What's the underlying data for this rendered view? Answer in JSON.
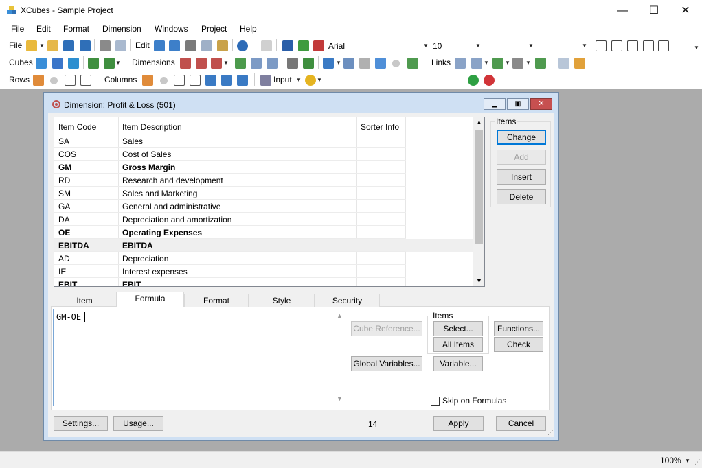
{
  "window": {
    "title": "XCubes - Sample Project",
    "minimize": "—",
    "maximize": "☐",
    "close": "✕"
  },
  "menu": [
    "File",
    "Edit",
    "Format",
    "Dimension",
    "Windows",
    "Project",
    "Help"
  ],
  "toolbar1": {
    "file_label": "File",
    "edit_label": "Edit",
    "font_name": "Arial",
    "font_size": "10"
  },
  "toolbar2": {
    "cubes_label": "Cubes",
    "dimensions_label": "Dimensions",
    "links_label": "Links"
  },
  "toolbar3": {
    "rows_label": "Rows",
    "columns_label": "Columns",
    "input_label": "Input"
  },
  "dialog": {
    "title": "Dimension: Profit & Loss (501)",
    "grid": {
      "headers": [
        "Item Code",
        "Item Description",
        "Sorter Info"
      ],
      "rows": [
        {
          "code": "SA",
          "desc": "Sales",
          "bold": false
        },
        {
          "code": "COS",
          "desc": "Cost of Sales",
          "bold": false
        },
        {
          "code": "GM",
          "desc": "Gross Margin",
          "bold": true
        },
        {
          "code": "RD",
          "desc": "Research and development",
          "bold": false
        },
        {
          "code": "SM",
          "desc": "Sales and Marketing",
          "bold": false
        },
        {
          "code": "GA",
          "desc": "General and administrative",
          "bold": false
        },
        {
          "code": "DA",
          "desc": "Depreciation and amortization",
          "bold": false
        },
        {
          "code": "OE",
          "desc": "Operating Expenses",
          "bold": true
        },
        {
          "code": "EBITDA",
          "desc": "EBITDA",
          "bold": true,
          "selected": true
        },
        {
          "code": "AD",
          "desc": "Depreciation",
          "bold": false
        },
        {
          "code": "IE",
          "desc": "Interest expenses",
          "bold": false
        },
        {
          "code": "EBIT",
          "desc": "EBIT",
          "bold": true
        }
      ]
    },
    "items_group": {
      "label": "Items",
      "change": "Change",
      "add": "Add",
      "insert": "Insert",
      "delete": "Delete"
    },
    "tabs": [
      "Item",
      "Formula",
      "Format",
      "Style",
      "Security"
    ],
    "active_tab": "Formula",
    "formula": {
      "text": "GM-OE",
      "cube_reference": "Cube Reference...",
      "global_variables": "Global Variables...",
      "items_label": "Items",
      "select": "Select...",
      "all_items": "All Items",
      "variable": "Variable...",
      "functions": "Functions...",
      "check": "Check",
      "skip_on_formulas": "Skip on Formulas"
    },
    "footer": {
      "settings": "Settings...",
      "usage": "Usage...",
      "count": "14",
      "apply": "Apply",
      "cancel": "Cancel"
    }
  },
  "status": {
    "zoom": "100%"
  },
  "colors": {
    "accent": "#0078d7",
    "workspace": "#ababab",
    "dialog_frame": "#cfe0f3",
    "close_red": "#c75050"
  }
}
